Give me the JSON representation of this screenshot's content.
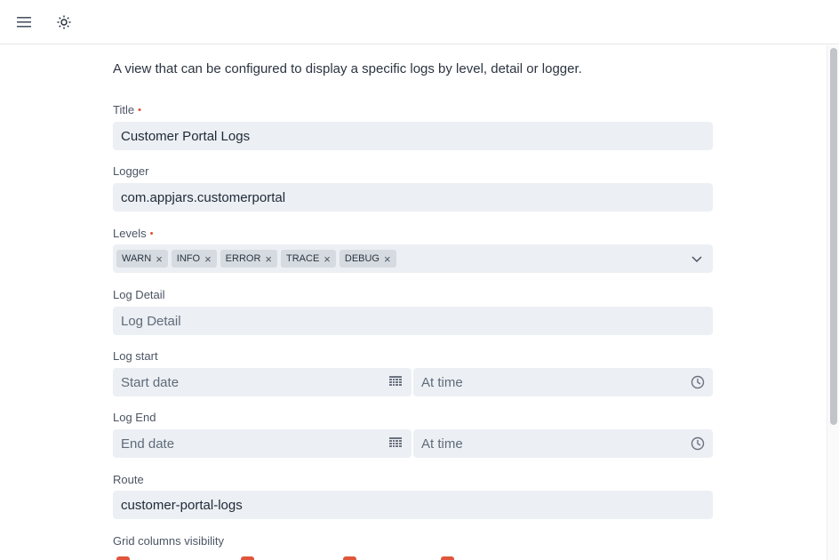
{
  "header": {
    "menu_icon": "menu-icon",
    "theme_icon": "sun-icon"
  },
  "description": "A view that can be configured to display a specific logs by level, detail or logger.",
  "fields": {
    "title": {
      "label": "Title",
      "value": "Customer Portal Logs",
      "required": "•"
    },
    "logger": {
      "label": "Logger",
      "value": "com.appjars.customerportal"
    },
    "levels": {
      "label": "Levels",
      "required": "•",
      "tags": [
        "WARN",
        "INFO",
        "ERROR",
        "TRACE",
        "DEBUG"
      ]
    },
    "log_detail": {
      "label": "Log Detail",
      "placeholder": "Log Detail"
    },
    "log_start": {
      "label": "Log start",
      "date_placeholder": "Start date",
      "time_placeholder": "At time"
    },
    "log_end": {
      "label": "Log End",
      "date_placeholder": "End date",
      "time_placeholder": "At time"
    },
    "route": {
      "label": "Route",
      "value": "customer-portal-logs"
    },
    "grid_columns": {
      "label": "Grid columns visibility"
    }
  },
  "colors": {
    "accent": "#e0553b",
    "required": "#e0482c",
    "field_bg": "#eceff3"
  }
}
